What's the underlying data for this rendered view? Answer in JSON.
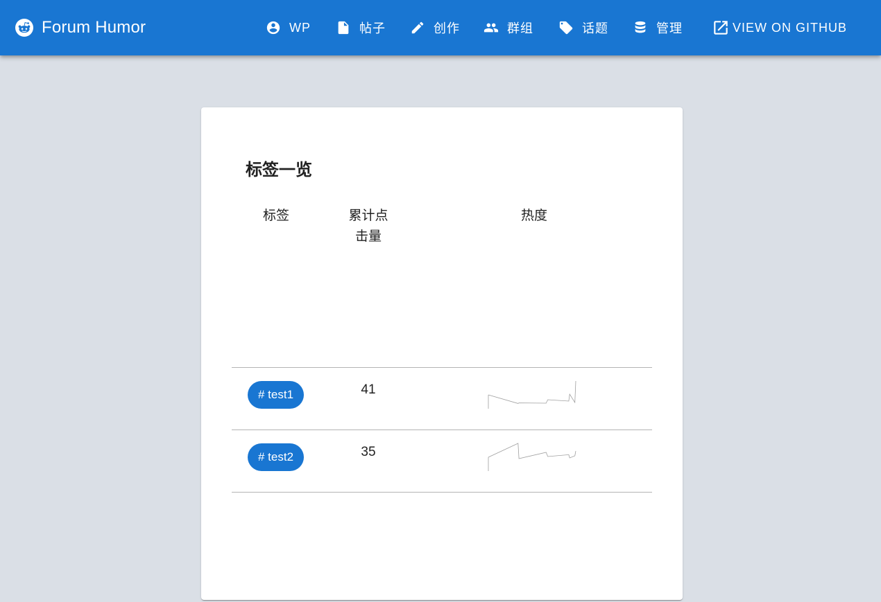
{
  "app": {
    "title": "Forum Humor",
    "logo_icon": "reddit-alien-icon",
    "bar_color": "#1976d2"
  },
  "nav": [
    {
      "label": "WP",
      "icon": "account-circle-icon"
    },
    {
      "label": "帖子",
      "icon": "file-icon"
    },
    {
      "label": "创作",
      "icon": "pencil-icon"
    },
    {
      "label": "群组",
      "icon": "people-icon"
    },
    {
      "label": "话题",
      "icon": "tag-icon"
    },
    {
      "label": "管理",
      "icon": "database-icon"
    },
    {
      "label": "VIEW ON GITHUB",
      "icon": "open-in-new-icon"
    }
  ],
  "page": {
    "title": "标签一览",
    "columns": [
      "标签",
      "累计点击量",
      "热度"
    ],
    "rows": [
      {
        "tag": "# test1",
        "clicks": "41",
        "trend": [
          0.0,
          -0.62,
          -0.58,
          -0.6,
          -0.35,
          -0.45,
          0.05,
          -0.55,
          1.0
        ]
      },
      {
        "tag": "# test2",
        "clicks": "35",
        "trend": [
          0.0,
          1.0,
          -0.1,
          0.35,
          0.05,
          0.18,
          -0.05,
          0.1,
          0.45
        ]
      }
    ]
  }
}
